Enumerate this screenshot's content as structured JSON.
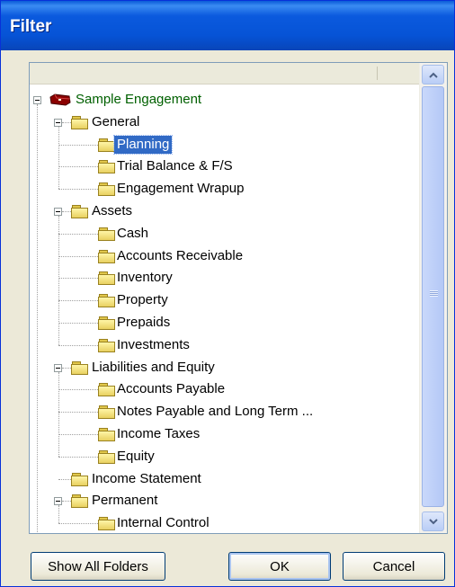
{
  "window": {
    "title": "Filter"
  },
  "tree": {
    "root": "Sample Engagement",
    "nodes": [
      {
        "label": "General",
        "children": [
          "Planning",
          "Trial Balance & F/S",
          "Engagement Wrapup"
        ]
      },
      {
        "label": "Assets",
        "children": [
          "Cash",
          "Accounts Receivable",
          "Inventory",
          "Property",
          "Prepaids",
          "Investments"
        ]
      },
      {
        "label": "Liabilities and Equity",
        "children": [
          "Accounts Payable",
          "Notes Payable and Long Term ...",
          "Income Taxes",
          "Equity"
        ]
      },
      {
        "label": "Income Statement",
        "children": []
      },
      {
        "label": "Permanent",
        "children": [
          "Internal Control"
        ]
      }
    ],
    "selected": "Planning"
  },
  "buttons": {
    "show_all": "Show All Folders",
    "ok": "OK",
    "cancel": "Cancel"
  },
  "colors": {
    "titlebar": "#0653d6",
    "selection": "#316ac5",
    "root_text": "#006000"
  }
}
